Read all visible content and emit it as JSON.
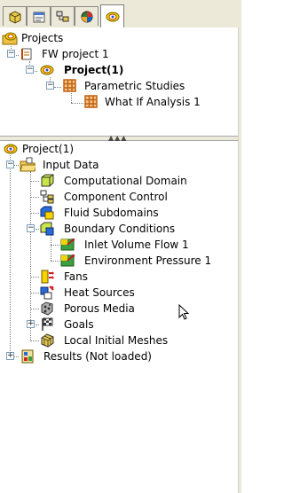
{
  "tabs": [
    {
      "icon": "feature-manager-icon",
      "active": false
    },
    {
      "icon": "property-manager-icon",
      "active": false
    },
    {
      "icon": "configuration-manager-icon",
      "active": false
    },
    {
      "icon": "appearance-manager-icon",
      "active": false
    },
    {
      "icon": "flow-simulation-icon",
      "active": true
    }
  ],
  "top_tree": {
    "root": "Projects",
    "project": "FW project 1",
    "configuration": "Project(1)",
    "studies": "Parametric Studies",
    "study": "What If Analysis 1"
  },
  "bottom_tree": {
    "root": "Project(1)",
    "input_data": "Input Data",
    "items": {
      "computational_domain": "Computational Domain",
      "component_control": "Component Control",
      "fluid_subdomains": "Fluid Subdomains",
      "boundary_conditions": "Boundary Conditions",
      "inlet_volume_flow": "Inlet Volume Flow 1",
      "environment_pressure": "Environment Pressure 1",
      "fans": "Fans",
      "heat_sources": "Heat Sources",
      "porous_media": "Porous Media",
      "goals": "Goals",
      "local_initial_meshes": "Local Initial Meshes"
    },
    "results": "Results (Not loaded)"
  },
  "colors": {
    "panel": "#ece9d8",
    "selection_bold": "#000000",
    "tree_line": "#808080"
  }
}
